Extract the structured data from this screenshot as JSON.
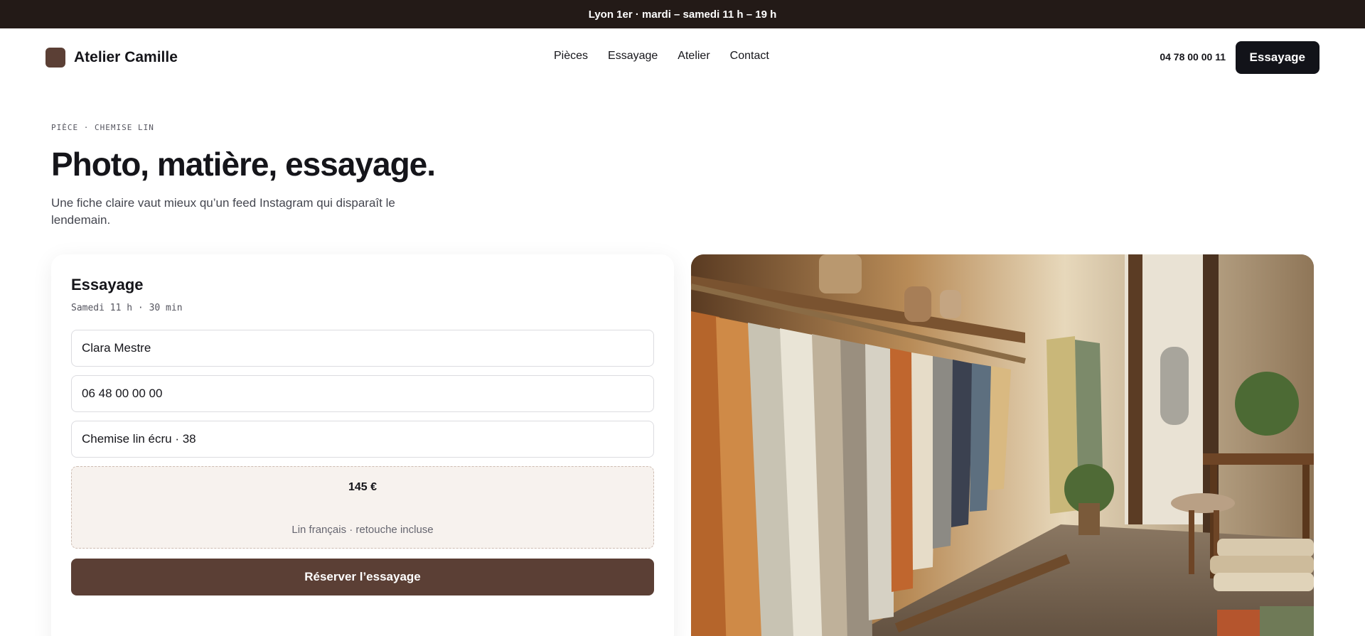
{
  "topbar": {
    "text": "Lyon 1er · mardi – samedi 11 h – 19 h"
  },
  "header": {
    "brand": "Atelier Camille",
    "nav": [
      "Pièces",
      "Essayage",
      "Atelier",
      "Contact"
    ],
    "phone": "04 78 00 00 11",
    "cta": "Essayage"
  },
  "hero": {
    "eyebrow": "PIÈCE · CHEMISE LIN",
    "title": "Photo, matière, essayage.",
    "subtitle": "Une fiche claire vaut mieux qu’un feed Instagram qui disparaît le lendemain."
  },
  "booking": {
    "title": "Essayage",
    "slot": "Samedi 11 h · 30 min",
    "name_value": "Clara Mestre",
    "phone_value": "06 48 00 00 00",
    "item_value": "Chemise lin écru · 38",
    "price": "145 €",
    "price_note": "Lin français · retouche incluse",
    "submit": "Réserver l’essayage"
  },
  "colors": {
    "topbar": "#231a17",
    "accent": "#5b3f35",
    "dark_button": "#121319",
    "price_bg": "#f7f2ee"
  },
  "icons": [
    "brand-logo-icon"
  ]
}
